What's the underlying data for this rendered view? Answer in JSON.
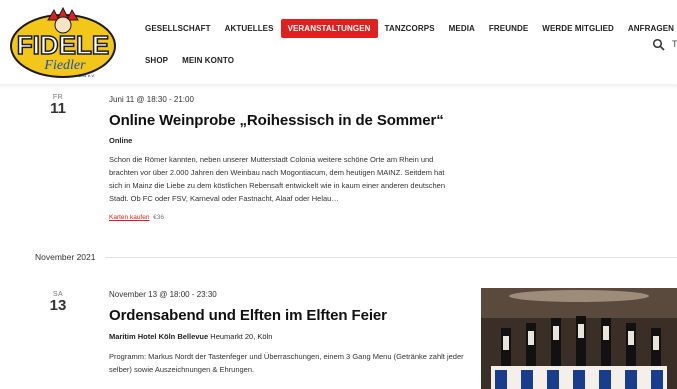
{
  "logo": {
    "main_text": "FIDELE",
    "script_text": "Fiedler",
    "year_text": "1891 e.V."
  },
  "nav": {
    "row1": [
      {
        "label": "Gesellschaft",
        "active": false
      },
      {
        "label": "Aktuelles",
        "active": false
      },
      {
        "label": "Veranstaltungen",
        "active": true
      },
      {
        "label": "Tanzcorps",
        "active": false
      },
      {
        "label": "Media",
        "active": false
      },
      {
        "label": "Freunde",
        "active": false
      },
      {
        "label": "Werde Mitglied",
        "active": false
      },
      {
        "label": "Anfragen",
        "active": false
      }
    ],
    "row2": [
      {
        "label": "Shop"
      },
      {
        "label": "Mein Konto"
      }
    ],
    "edge_mark": "T"
  },
  "events": [
    {
      "dow": "Fr",
      "day": "11",
      "time": "Juni 11 @ 18:30 - 21:00",
      "title": "Online Weinprobe „Roihessisch in de Sommer“",
      "venue_name": "Online",
      "venue_address": "",
      "description": "Schon die Römer kannten, neben unserer Mutterstadt Colonia weitere schöne Orte am Rhein und brachten vor über 2.000 Jahren den Weinbau nach Mogontiacum, dem heutigen MAINZ. Seitdem hat sich in Mainz die Liebe zu dem köstlichen Rebensaft entwickelt wie in kaum einer anderen deutschen Stadt. Ob FC oder FSV, Karneval oder Fastnacht, Alaaf oder Helau…",
      "ticket_link": "Karten kaufen",
      "price": "€36"
    },
    {
      "dow": "Sa",
      "day": "13",
      "time": "November 13 @ 18:00 - 23:30",
      "title": "Ordensabend und Elften im Elften Feier",
      "venue_name": "Maritim Hotel Köln Bellevue",
      "venue_address": "Heumarkt 20, Köln",
      "description": "Programm: Markus Nordt der Tastenfeger und Überraschungen, einem 3 Gang Menu (Getränke zahlt jeder selber) sowie Auszeichnungen & Ehrungen."
    }
  ],
  "month_separator": "November 2021",
  "colors": {
    "accent": "#e0201e",
    "logo_yellow": "#f3c61a",
    "logo_blue": "#1b4fb5"
  }
}
